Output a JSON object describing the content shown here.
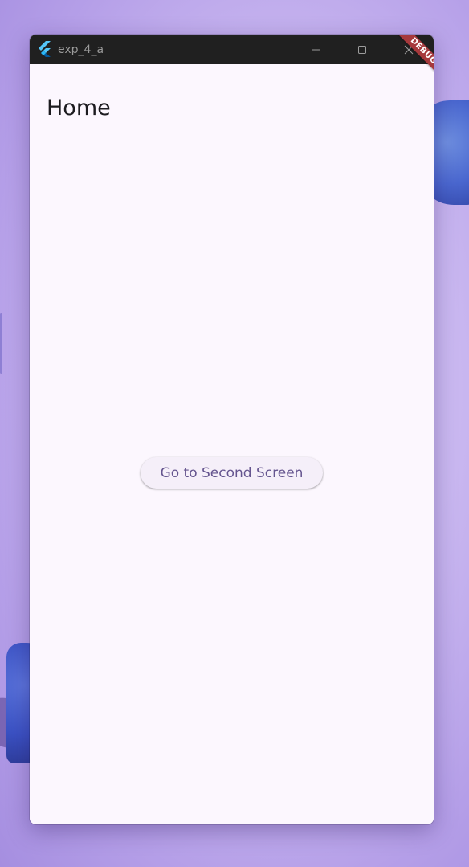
{
  "window": {
    "title": "exp_4_a",
    "controls": {
      "minimize_icon": "minimize-icon",
      "maximize_icon": "maximize-icon",
      "close_icon": "close-icon"
    }
  },
  "app_bar": {
    "title": "Home"
  },
  "main": {
    "button_label": "Go to Second Screen"
  },
  "debug_banner": {
    "label": "DEBUG"
  },
  "colors": {
    "titlebar": "#202020",
    "surface": "#fcf7fe",
    "button_text": "#65558f",
    "debug_ribbon": "#a6393c"
  }
}
